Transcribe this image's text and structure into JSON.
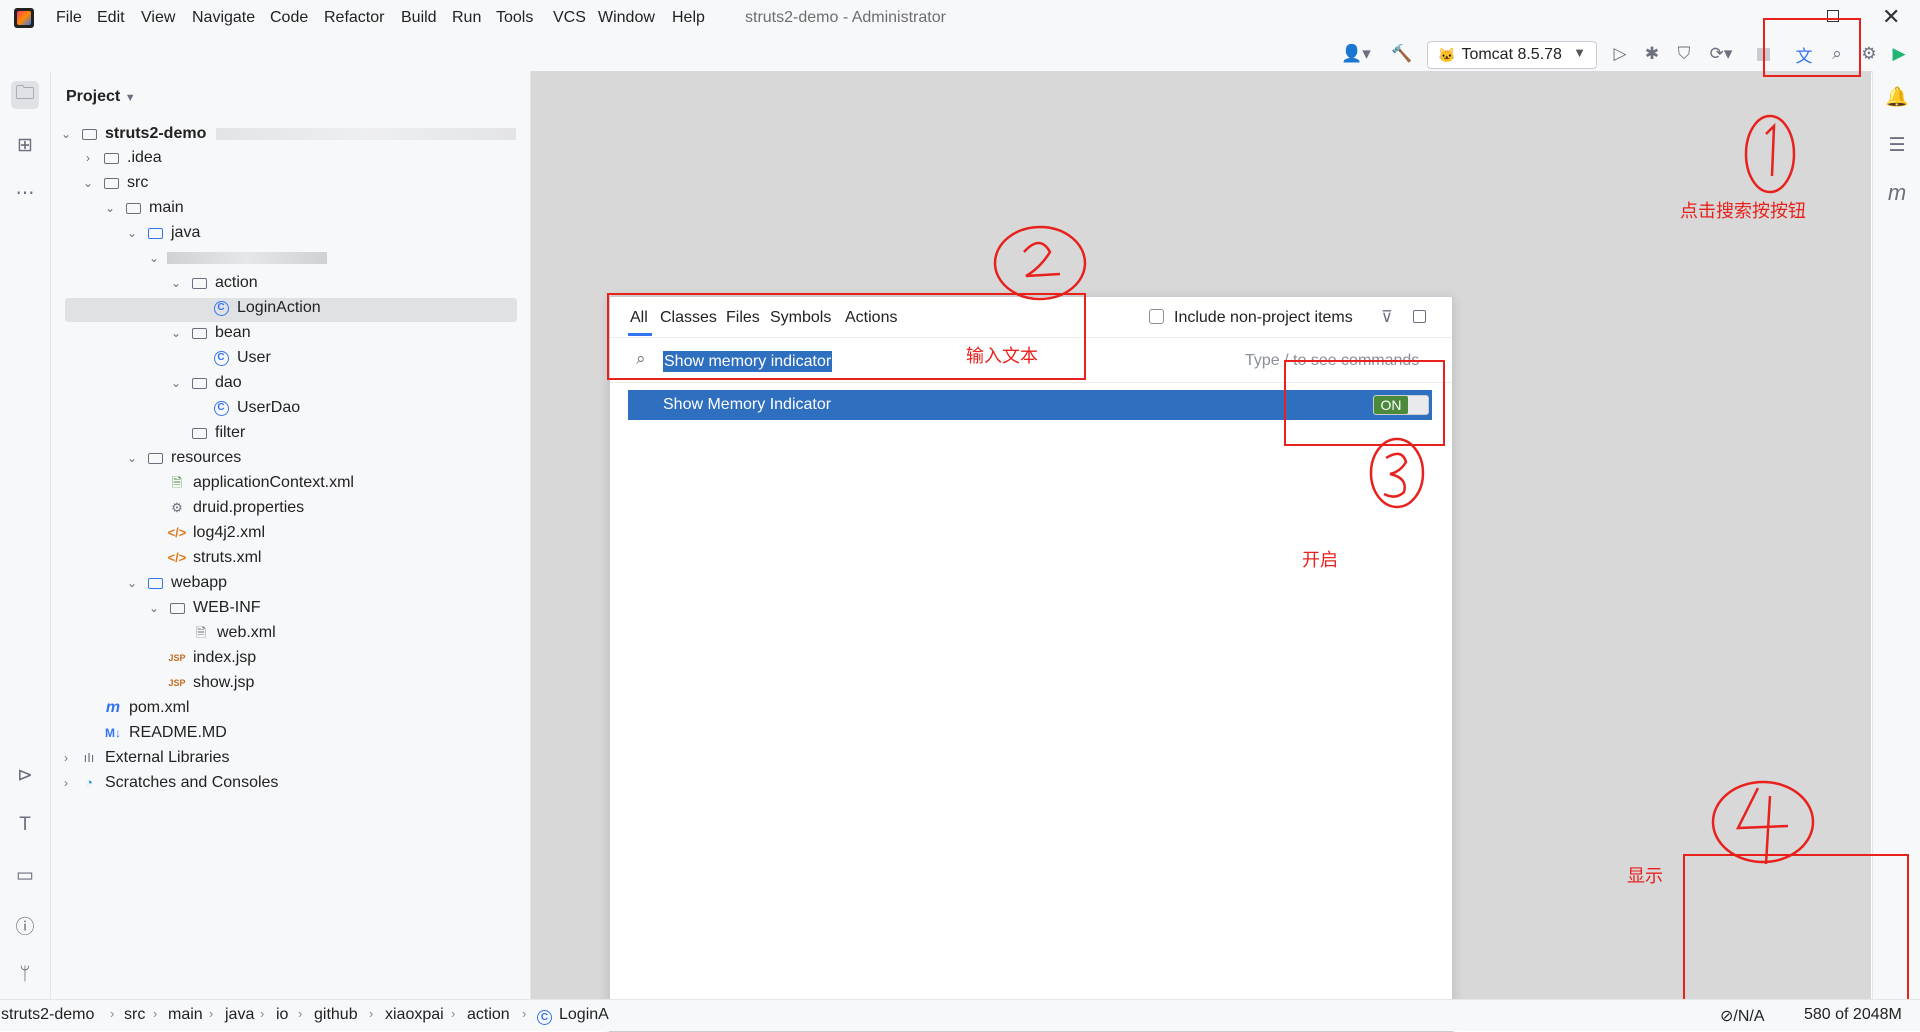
{
  "menu": [
    "File",
    "Edit",
    "View",
    "Navigate",
    "Code",
    "Refactor",
    "Build",
    "Run",
    "Tools",
    "VCS",
    "Window",
    "Help"
  ],
  "window_title": "struts2-demo - Administrator",
  "run_config": "Tomcat 8.5.78",
  "project_panel": {
    "title": "Project",
    "root": "struts2-demo",
    "items": [
      ".idea",
      "src",
      "main",
      "java",
      "action",
      "LoginAction",
      "bean",
      "User",
      "dao",
      "UserDao",
      "filter",
      "resources",
      "applicationContext.xml",
      "druid.properties",
      "log4j2.xml",
      "struts.xml",
      "webapp",
      "WEB-INF",
      "web.xml",
      "index.jsp",
      "show.jsp",
      "pom.xml",
      "README.MD",
      "External Libraries",
      "Scratches and Consoles"
    ]
  },
  "search_popup": {
    "tabs": [
      "All",
      "Classes",
      "Files",
      "Symbols",
      "Actions"
    ],
    "include_label": "Include non-project items",
    "query": "Show memory indicator",
    "hint": "Type / to see commands",
    "result_label": "Show Memory Indicator",
    "toggle_label": "ON"
  },
  "annotations": {
    "step1": "点击搜索按按钮",
    "step2": "输入文本",
    "step3": "开启",
    "step4": "显示"
  },
  "breadcrumb": [
    "struts2-demo",
    "src",
    "main",
    "java",
    "io",
    "github",
    "xiaoxpai",
    "action",
    "LoginA"
  ],
  "memory_indicator": {
    "prefix": "⊘/N/A",
    "value": "580 of 2048M"
  },
  "colors": {
    "selection": "#2f6fc0",
    "annotation": "#e8211d",
    "toggle_on": "#4a8a3a"
  }
}
